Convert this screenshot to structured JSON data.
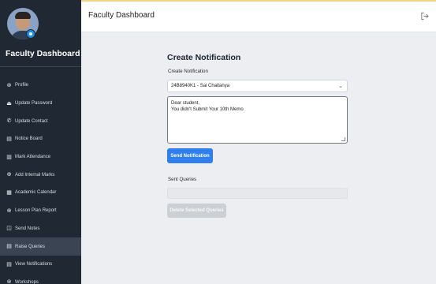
{
  "sidebar": {
    "title": "Faculty Dashboard",
    "items": [
      {
        "label": "Profile",
        "icon": "user-icon",
        "glyph": "⊛"
      },
      {
        "label": "Update Password",
        "icon": "lock-icon",
        "glyph": "⏏"
      },
      {
        "label": "Update Contact",
        "icon": "phone-icon",
        "glyph": "✆"
      },
      {
        "label": "Notice Board",
        "icon": "clipboard-icon",
        "glyph": "▤"
      },
      {
        "label": "Mark Attendance",
        "icon": "checklist-icon",
        "glyph": "▥"
      },
      {
        "label": "Add Internal Marks",
        "icon": "plus-circle-icon",
        "glyph": "⊕"
      },
      {
        "label": "Academic Calendar",
        "icon": "calendar-icon",
        "glyph": "▦"
      },
      {
        "label": "Lesson Plan Report",
        "icon": "report-icon",
        "glyph": "⊕"
      },
      {
        "label": "Send Notes",
        "icon": "notes-icon",
        "glyph": "◫"
      },
      {
        "label": "Raise Queries",
        "icon": "question-icon",
        "glyph": "▤"
      },
      {
        "label": "View Notifications",
        "icon": "bell-icon",
        "glyph": "▤"
      },
      {
        "label": "Workshops",
        "icon": "workshop-icon",
        "glyph": "⊛"
      }
    ],
    "active_index": 9
  },
  "header": {
    "title": "Faculty Dashboard",
    "logout_icon": "logout-icon"
  },
  "form": {
    "title": "Create Notification",
    "field_label": "Create Notification",
    "selected_student": "24B8940K1 - Sai Chaitanya",
    "message_line1": "Dear student,",
    "message_line2": "You didn't Submit Your 10th Memo",
    "send_button": "Send Notification",
    "sent_label": "Sent Queries",
    "delete_button": "Delete Selected Queries"
  },
  "colors": {
    "sidebar_bg": "#1f2833",
    "primary": "#2f7fee",
    "disabled": "#ccd0d5",
    "content_bg": "#eceef1"
  }
}
